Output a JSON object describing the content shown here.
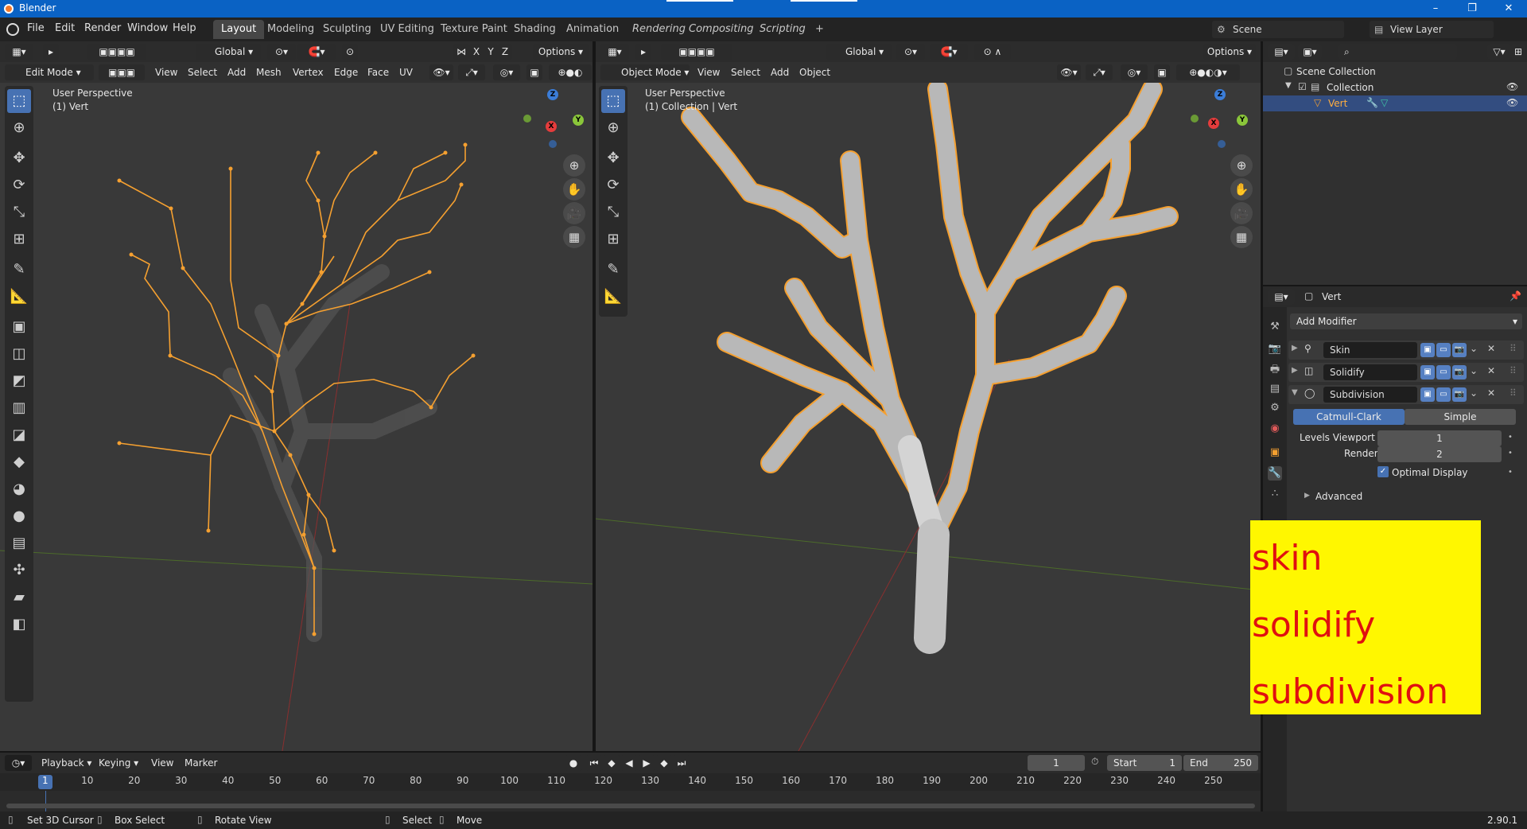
{
  "window": {
    "title": "Blender",
    "minimize": "–",
    "maximize": "❐",
    "close": "✕"
  },
  "menu": {
    "items": [
      "File",
      "Edit",
      "Render",
      "Window",
      "Help"
    ]
  },
  "workspaces": {
    "tabs": [
      "Layout",
      "Modeling",
      "Sculpting",
      "UV Editing",
      "Texture Paint",
      "Shading",
      "Animation",
      "Rendering",
      "Compositing",
      "Scripting"
    ],
    "add": "+"
  },
  "scene": {
    "name": "Scene",
    "view_layer": "View Layer"
  },
  "left_viewport": {
    "transform": "Global",
    "options": "Options",
    "axes": [
      "X",
      "Y",
      "Z"
    ],
    "mode": "Edit Mode",
    "menus": [
      "View",
      "Select",
      "Add",
      "Mesh",
      "Vertex",
      "Edge",
      "Face",
      "UV"
    ],
    "overlay_title": "User Perspective",
    "overlay_sub": "(1) Vert"
  },
  "right_viewport": {
    "transform": "Global",
    "options": "Options",
    "mode": "Object Mode",
    "menus": [
      "View",
      "Select",
      "Add",
      "Object"
    ],
    "overlay_title": "User Perspective",
    "overlay_sub": "(1) Collection | Vert"
  },
  "gizmo": {
    "x": "X",
    "y": "Y",
    "z": "Z"
  },
  "outliner": {
    "root": "Scene Collection",
    "collection": "Collection",
    "object": "Vert"
  },
  "properties": {
    "object_name": "Vert",
    "add_modifier": "Add Modifier",
    "modifiers": [
      "Skin",
      "Solidify",
      "Subdivision"
    ],
    "subdivision": {
      "algorithms": [
        "Catmull-Clark",
        "Simple"
      ],
      "levels_viewport_label": "Levels Viewport",
      "levels_viewport": "1",
      "render_label": "Render",
      "render": "2",
      "optimal_display": "Optimal Display",
      "advanced": "Advanced"
    }
  },
  "timeline": {
    "menus": [
      "Playback",
      "Keying",
      "View",
      "Marker"
    ],
    "current_frame": "1",
    "start_label": "Start",
    "start": "1",
    "end_label": "End",
    "end": "250",
    "ticks": [
      "1",
      "10",
      "20",
      "30",
      "40",
      "50",
      "60",
      "70",
      "80",
      "90",
      "100",
      "110",
      "120",
      "130",
      "140",
      "150",
      "160",
      "170",
      "180",
      "190",
      "200",
      "210",
      "220",
      "230",
      "240",
      "250"
    ]
  },
  "statusbar": {
    "items": [
      "Set 3D Cursor",
      "Box Select",
      "Rotate View",
      "Select",
      "Move"
    ],
    "version": "2.90.1"
  },
  "annotation": {
    "lines": [
      "skin",
      "solidify",
      "subdivision"
    ]
  },
  "colors": {
    "accent": "#4772b3",
    "selection": "#f5a030",
    "annotation_bg": "#fff700",
    "annotation_text": "#e01010"
  }
}
